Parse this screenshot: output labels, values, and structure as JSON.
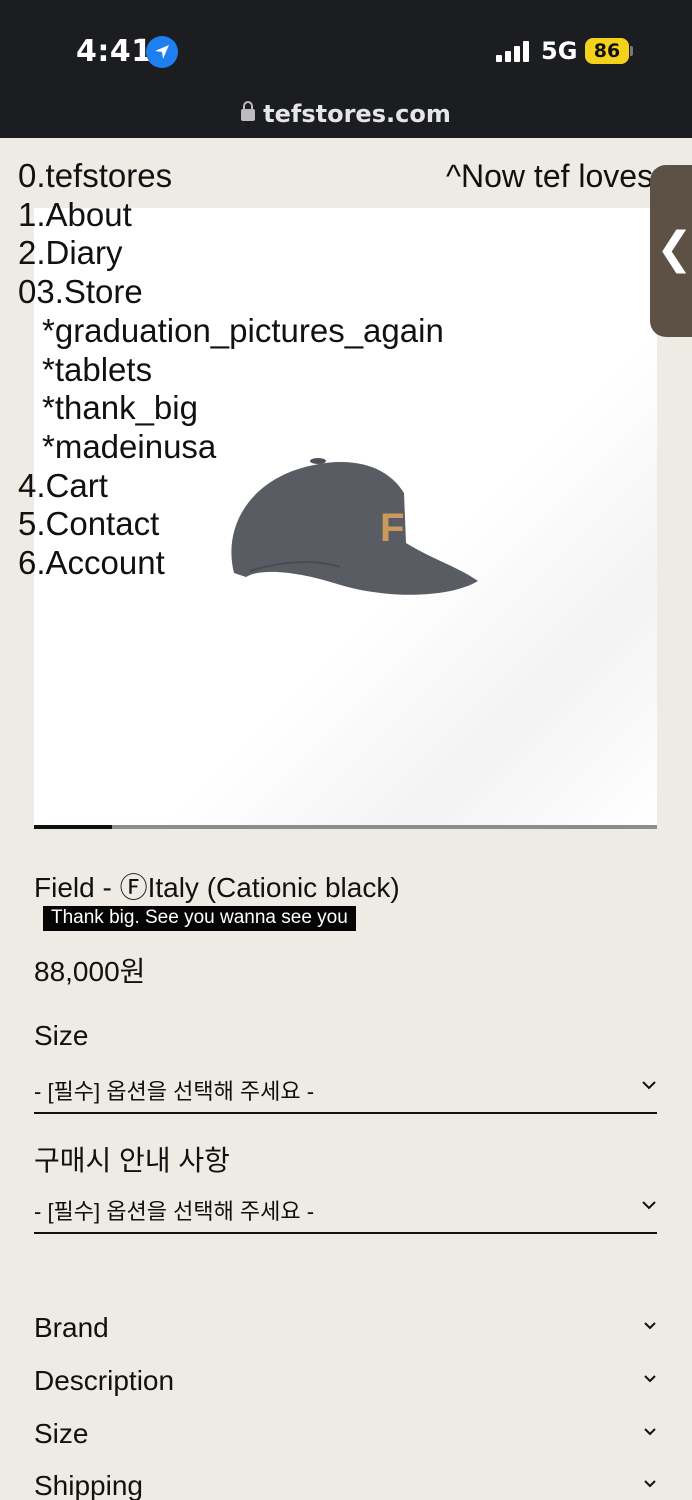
{
  "status_bar": {
    "time": "4:41",
    "network": "5G",
    "battery": "86"
  },
  "browser": {
    "url": "tefstores.com"
  },
  "top_note": "^Now tef loves",
  "nav": {
    "items": [
      "0.tefstores",
      "1.About",
      "2.Diary",
      "03.Store",
      "*graduation_pictures_again",
      "*tablets",
      "*thank_big",
      "*madeinusa",
      "4.Cart",
      "5.Contact",
      "6.Account"
    ]
  },
  "side_tab": {
    "glyph": "❮"
  },
  "gallery": {
    "progress": 0.125
  },
  "product": {
    "title": "Field - ⒻItaly (Cationic black)",
    "tagline": "Thank big. See you wanna see you",
    "price": "88,000원"
  },
  "options": [
    {
      "label": "Size",
      "placeholder": "- [필수] 옵션을 선택해 주세요 -"
    },
    {
      "label": "구매시 안내 사항",
      "placeholder": "- [필수] 옵션을 선택해 주세요 -"
    }
  ],
  "accordion": [
    "Brand",
    "Description",
    "Size",
    "Shipping"
  ],
  "colors": {
    "page_background": "#edebe4",
    "status_bar": "#1b1d21",
    "location_icon": "#1e7ff0",
    "battery": "#f4d21c",
    "side_tab": "#5d5146",
    "cap": "#5a5c63",
    "cap_logo": "#c99a5c"
  }
}
